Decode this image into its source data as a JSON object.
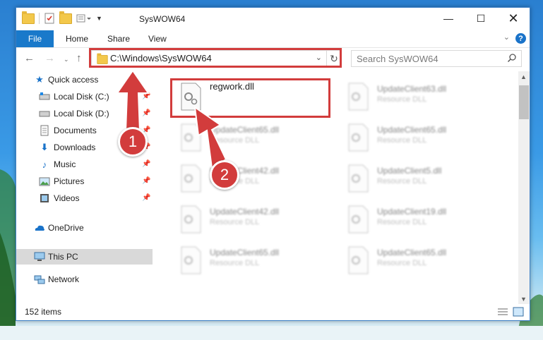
{
  "window": {
    "title": "SysWOW64"
  },
  "ribbon": {
    "tabs": [
      "File",
      "Home",
      "Share",
      "View"
    ]
  },
  "navbar": {
    "address": "C:\\Windows\\SysWOW64",
    "search_placeholder": "Search SysWOW64"
  },
  "sidebar": {
    "items": [
      {
        "label": "Quick access",
        "icon": "star-icon"
      },
      {
        "label": "Local Disk (C:)",
        "icon": "drive-icon",
        "pinned": true
      },
      {
        "label": "Local Disk (D:)",
        "icon": "drive-icon",
        "pinned": true
      },
      {
        "label": "Documents",
        "icon": "documents-icon",
        "pinned": true
      },
      {
        "label": "Downloads",
        "icon": "downloads-icon",
        "pinned": true
      },
      {
        "label": "Music",
        "icon": "music-icon",
        "pinned": true
      },
      {
        "label": "Pictures",
        "icon": "pictures-icon",
        "pinned": true
      },
      {
        "label": "Videos",
        "icon": "videos-icon",
        "pinned": true
      },
      {
        "label": "OneDrive",
        "icon": "onedrive-icon"
      },
      {
        "label": "This PC",
        "icon": "pc-icon",
        "selected": true
      },
      {
        "label": "Network",
        "icon": "network-icon"
      }
    ]
  },
  "files": {
    "highlighted": {
      "name": "regwork.dll"
    },
    "right_col": [
      {
        "name": "UpdateClient63.dll",
        "type": "Resource DLL"
      },
      {
        "name": "UpdateClient65.dll",
        "type": "Resource DLL"
      },
      {
        "name": "UpdateClient5.dll",
        "type": "Resource DLL"
      },
      {
        "name": "UpdateClient19.dll",
        "type": "Resource DLL"
      },
      {
        "name": "UpdateClient65.dll",
        "type": "Resource DLL"
      }
    ],
    "left_col": [
      {
        "name": "UpdateClient65.dll",
        "type": "Resource DLL"
      },
      {
        "name": "UpdateClient42.dll",
        "type": "Resource DLL"
      },
      {
        "name": "UpdateClient42.dll",
        "type": "Resource DLL"
      },
      {
        "name": "UpdateClient65.dll",
        "type": "Resource DLL"
      }
    ]
  },
  "status": {
    "item_count": "152 items"
  },
  "callouts": {
    "first": "1",
    "second": "2"
  },
  "colors": {
    "accent": "#1979ca",
    "highlight": "#d23c3c"
  }
}
